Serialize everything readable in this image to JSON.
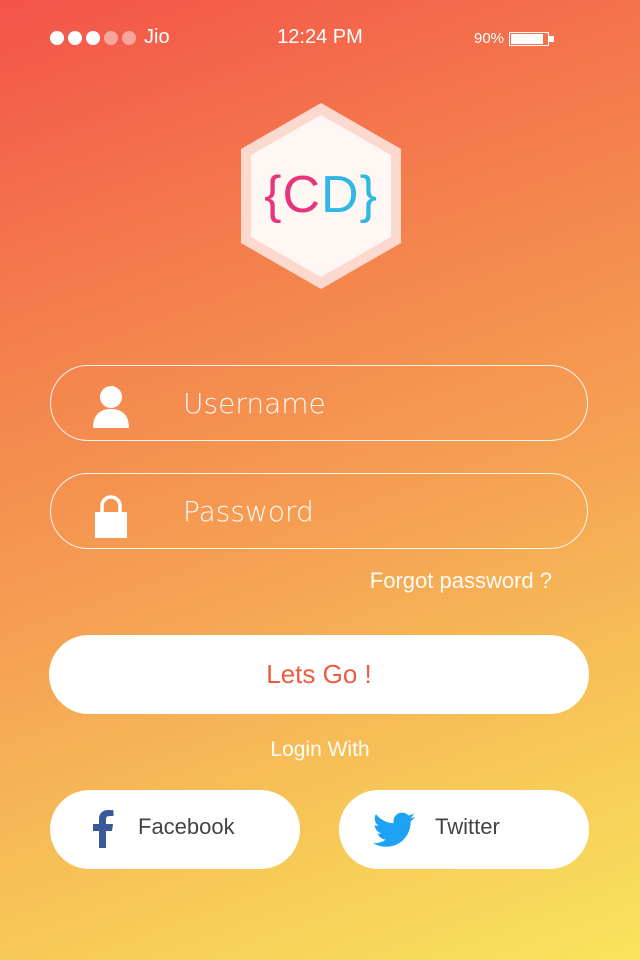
{
  "status_bar": {
    "signal_bars": 5,
    "signal_filled": 3,
    "carrier": "Jio",
    "time": "12:24 PM",
    "battery_percent": "90%",
    "battery_level": 0.9
  },
  "logo": {
    "open_brace": "{",
    "letter_c": "C",
    "letter_d": "D",
    "close_brace": "}",
    "brand_pink": "#e8357a",
    "brand_blue": "#2fb8e6"
  },
  "form": {
    "username": {
      "placeholder": "Username",
      "value": "",
      "icon": "user-icon"
    },
    "password": {
      "placeholder": "Password",
      "value": "",
      "icon": "lock-icon"
    },
    "forgot_label": "Forgot password ?",
    "submit_label": "Lets Go !"
  },
  "social": {
    "heading": "Login With",
    "facebook": {
      "label": "Facebook",
      "icon": "facebook-icon",
      "color": "#3b5998"
    },
    "twitter": {
      "label": "Twitter",
      "icon": "twitter-icon",
      "color": "#1da1f2"
    }
  },
  "colors": {
    "gradient_start": "#f3534a",
    "gradient_end": "#f9e45c",
    "button_text": "#ef5a41"
  }
}
